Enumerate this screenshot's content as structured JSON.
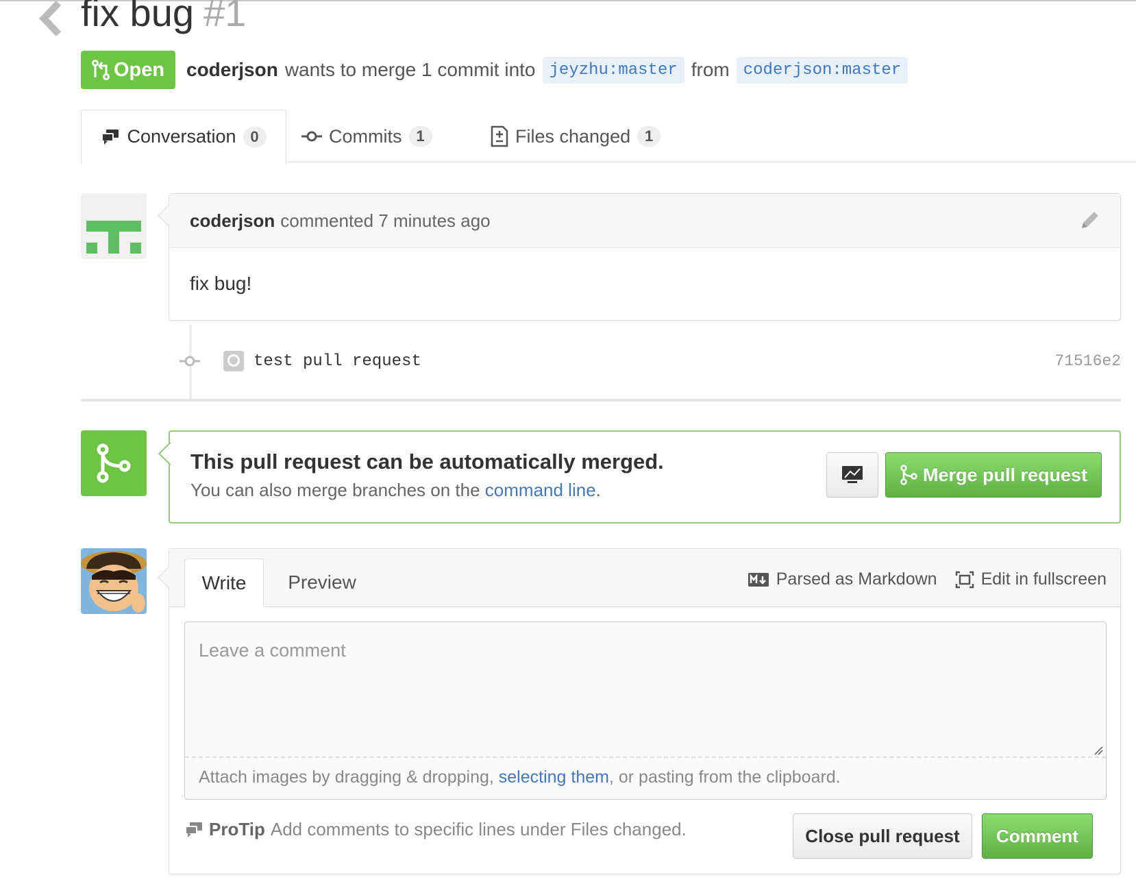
{
  "pr": {
    "title": "fix bug",
    "number": "#1",
    "state": "Open",
    "state_color": "#6cc644",
    "author": "coderjson",
    "merge_text": "wants to merge 1 commit into",
    "base_branch": "jeyzhu:master",
    "from_text": "from",
    "head_branch": "coderjson:master"
  },
  "tabs": [
    {
      "label": "Conversation",
      "count": "0",
      "icon": "comment-discussion-icon"
    },
    {
      "label": "Commits",
      "count": "1",
      "icon": "git-commit-icon"
    },
    {
      "label": "Files changed",
      "count": "1",
      "icon": "file-diff-icon"
    }
  ],
  "comment": {
    "author": "coderjson",
    "meta": "commented 7 minutes ago",
    "body": "fix bug!"
  },
  "commit": {
    "message": "test pull request",
    "sha": "71516e2"
  },
  "merge": {
    "title": "This pull request can be automatically merged.",
    "subtitle_pre": "You can also merge branches on the",
    "subtitle_link": "command line",
    "subtitle_post": ".",
    "button_label": "Merge pull request"
  },
  "form": {
    "tab_write": "Write",
    "tab_preview": "Preview",
    "markdown_label": "Parsed as Markdown",
    "fullscreen_label": "Edit in fullscreen",
    "placeholder": "Leave a comment",
    "attach_pre": "Attach images by dragging & dropping,",
    "attach_link": "selecting them",
    "attach_post": ", or pasting from the clipboard.",
    "protip_label": "ProTip",
    "protip_text": "Add comments to specific lines under Files changed.",
    "close_label": "Close pull request",
    "comment_label": "Comment"
  },
  "colors": {
    "accent_green": "#6cc644",
    "link_blue": "#4078c0"
  }
}
